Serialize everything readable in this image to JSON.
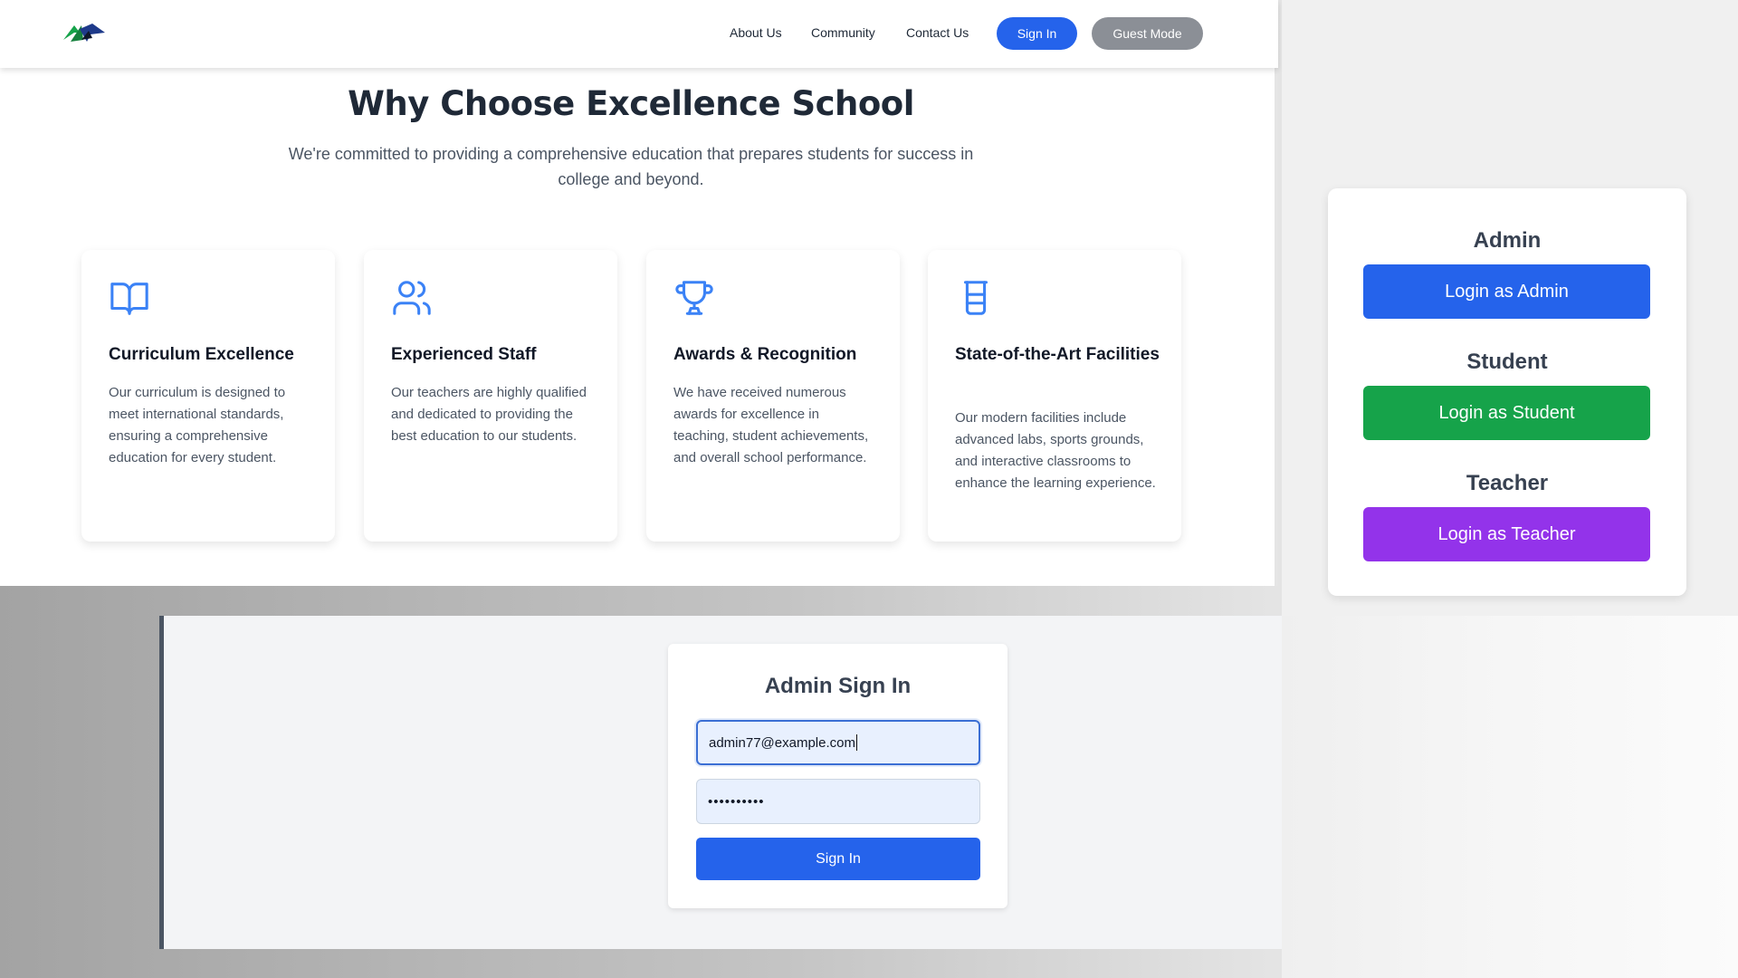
{
  "nav": {
    "links": [
      "About Us",
      "Community",
      "Contact Us"
    ],
    "sign_in": "Sign In",
    "guest_mode": "Guest Mode"
  },
  "hero": {
    "title": "Why Choose Excellence School",
    "subtitle": "We're committed to providing a comprehensive education that prepares students for success in college and beyond."
  },
  "features": [
    {
      "icon": "book-open-icon",
      "title": "Curriculum Excellence",
      "description": "Our curriculum is designed to meet international standards, ensuring a comprehensive education for every student."
    },
    {
      "icon": "users-icon",
      "title": "Experienced Staff",
      "description": "Our teachers are highly qualified and dedicated to providing the best education to our students."
    },
    {
      "icon": "trophy-icon",
      "title": "Awards & Recognition",
      "description": "We have received numerous awards for excellence in teaching, student achievements, and overall school performance."
    },
    {
      "icon": "beaker-icon",
      "title": "State-of-the-Art Facilities",
      "description": "Our modern facilities include advanced labs, sports grounds, and interactive classrooms to enhance the learning experience."
    }
  ],
  "roles": [
    {
      "heading": "Admin",
      "button": "Login as Admin",
      "color": "#2563eb"
    },
    {
      "heading": "Student",
      "button": "Login as Student",
      "color": "#16a34a"
    },
    {
      "heading": "Teacher",
      "button": "Login as Teacher",
      "color": "#9333ea"
    }
  ],
  "signin": {
    "title": "Admin Sign In",
    "email_value": "admin77@example.com",
    "password_masked": "••••••••••",
    "button": "Sign In"
  },
  "colors": {
    "accent": "#2563eb",
    "icon": "#3b82f6"
  }
}
